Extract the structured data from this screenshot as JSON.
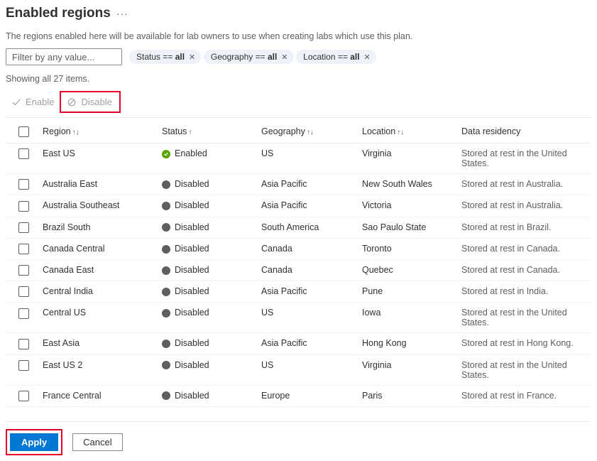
{
  "header": {
    "title": "Enabled regions"
  },
  "description": "The regions enabled here will be available for lab owners to use when creating labs which use this plan.",
  "filter": {
    "placeholder": "Filter by any value..."
  },
  "pills": [
    {
      "label": "Status == ",
      "value": "all"
    },
    {
      "label": "Geography == ",
      "value": "all"
    },
    {
      "label": "Location == ",
      "value": "all"
    }
  ],
  "count_line": "Showing all 27 items.",
  "actions": {
    "enable": "Enable",
    "disable": "Disable"
  },
  "columns": {
    "region": "Region",
    "status": "Status",
    "geography": "Geography",
    "location": "Location",
    "residency": "Data residency"
  },
  "rows": [
    {
      "region": "East US",
      "status": "Enabled",
      "status_kind": "enabled",
      "geography": "US",
      "location": "Virginia",
      "residency": "Stored at rest in the United States."
    },
    {
      "region": "Australia East",
      "status": "Disabled",
      "status_kind": "disabled",
      "geography": "Asia Pacific",
      "location": "New South Wales",
      "residency": "Stored at rest in Australia."
    },
    {
      "region": "Australia Southeast",
      "status": "Disabled",
      "status_kind": "disabled",
      "geography": "Asia Pacific",
      "location": "Victoria",
      "residency": "Stored at rest in Australia."
    },
    {
      "region": "Brazil South",
      "status": "Disabled",
      "status_kind": "disabled",
      "geography": "South America",
      "location": "Sao Paulo State",
      "residency": "Stored at rest in Brazil."
    },
    {
      "region": "Canada Central",
      "status": "Disabled",
      "status_kind": "disabled",
      "geography": "Canada",
      "location": "Toronto",
      "residency": "Stored at rest in Canada."
    },
    {
      "region": "Canada East",
      "status": "Disabled",
      "status_kind": "disabled",
      "geography": "Canada",
      "location": "Quebec",
      "residency": "Stored at rest in Canada."
    },
    {
      "region": "Central India",
      "status": "Disabled",
      "status_kind": "disabled",
      "geography": "Asia Pacific",
      "location": "Pune",
      "residency": "Stored at rest in India."
    },
    {
      "region": "Central US",
      "status": "Disabled",
      "status_kind": "disabled",
      "geography": "US",
      "location": "Iowa",
      "residency": "Stored at rest in the United States."
    },
    {
      "region": "East Asia",
      "status": "Disabled",
      "status_kind": "disabled",
      "geography": "Asia Pacific",
      "location": "Hong Kong",
      "residency": "Stored at rest in Hong Kong."
    },
    {
      "region": "East US 2",
      "status": "Disabled",
      "status_kind": "disabled",
      "geography": "US",
      "location": "Virginia",
      "residency": "Stored at rest in the United States."
    },
    {
      "region": "France Central",
      "status": "Disabled",
      "status_kind": "disabled",
      "geography": "Europe",
      "location": "Paris",
      "residency": "Stored at rest in France."
    }
  ],
  "footer": {
    "apply": "Apply",
    "cancel": "Cancel"
  }
}
